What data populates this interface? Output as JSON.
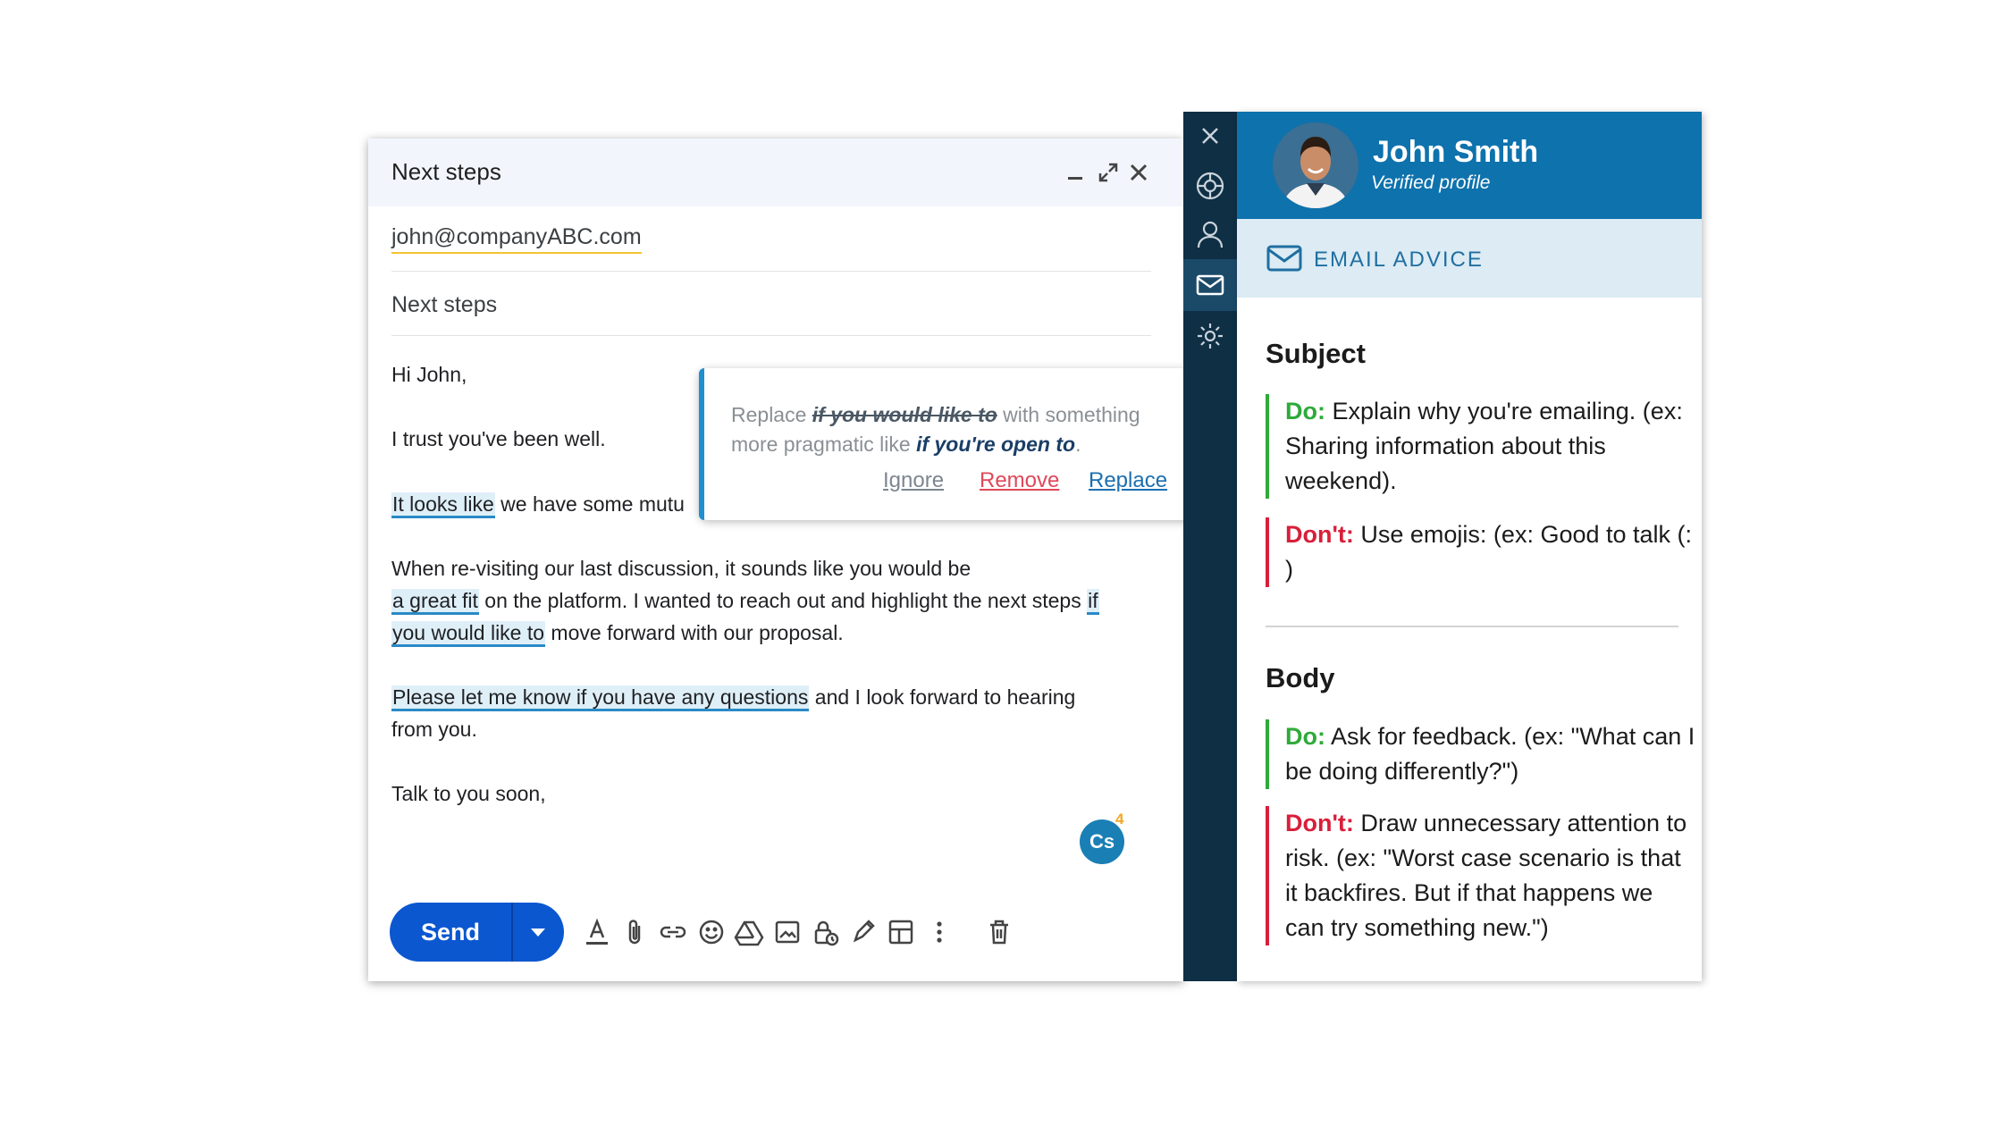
{
  "compose": {
    "title": "Next steps",
    "to": "john@companyABC.com",
    "subject": "Next steps",
    "body": {
      "greeting": "Hi John,",
      "p1": "I trust you've been well.",
      "p2_hl": "It looks like",
      "p2_rest": " we have some mutu",
      "p3_l1": "When re-visiting our last discussion, it sounds like you would be",
      "p3_hl1": "a great fit",
      "p3_mid": " on the platform. I wanted to reach out and highlight the next steps ",
      "p3_hl2a": "if",
      "p3_hl2b": "you would like to",
      "p3_end": " move forward with our proposal.",
      "p4_hl": "Please let me know if you have any questions",
      "p4_rest": " and I look forward to hearing",
      "p4_l2": "from you.",
      "signoff": "Talk to you soon,"
    },
    "badge": {
      "label": "Cs",
      "count": "4"
    },
    "send_label": "Send",
    "toolbar_icons": [
      "format-text-icon",
      "attach-icon",
      "link-icon",
      "emoji-icon",
      "drive-icon",
      "photo-icon",
      "confidential-icon",
      "signature-icon",
      "template-icon",
      "more-options-icon",
      "trash-icon"
    ]
  },
  "popup": {
    "prefix": "Replace ",
    "struck": "if you would like to",
    "middle": " with something more pragmatic like ",
    "suggestion": "if you're open to",
    "suffix": ".",
    "actions": {
      "ignore": "Ignore",
      "remove": "Remove",
      "replace": "Replace"
    },
    "colors": {
      "ignore": "#7d8690",
      "remove": "#e0485a",
      "replace": "#1b6fb0"
    }
  },
  "side_rail": [
    "close-icon",
    "target-icon",
    "person-icon",
    "mail-icon",
    "settings-icon"
  ],
  "profile": {
    "name": "John Smith",
    "status": "Verified profile"
  },
  "advice": {
    "header": "EMAIL ADVICE",
    "sections": [
      {
        "title": "Subject",
        "do_label": "Do:",
        "do_text": " Explain why you're emailing. (ex: Sharing information about this weekend).",
        "dont_label": "Don't:",
        "dont_text": " Use emojis: (ex: Good to talk (: )"
      },
      {
        "title": "Body",
        "do_label": "Do:",
        "do_text": " Ask for feedback. (ex: \"What can I be doing differently?\")",
        "dont_label": "Don't:",
        "dont_text": " Draw unnecessary attention to risk. (ex: \"Worst case scenario is that it backfires. But if that happens we can try something new.\")"
      }
    ]
  },
  "colors": {
    "accent_blue": "#0e72ad",
    "send_blue": "#0b57d0",
    "do_green": "#2eaa3a",
    "dont_red": "#d81f3a",
    "rail_dark": "#0f2f45"
  }
}
